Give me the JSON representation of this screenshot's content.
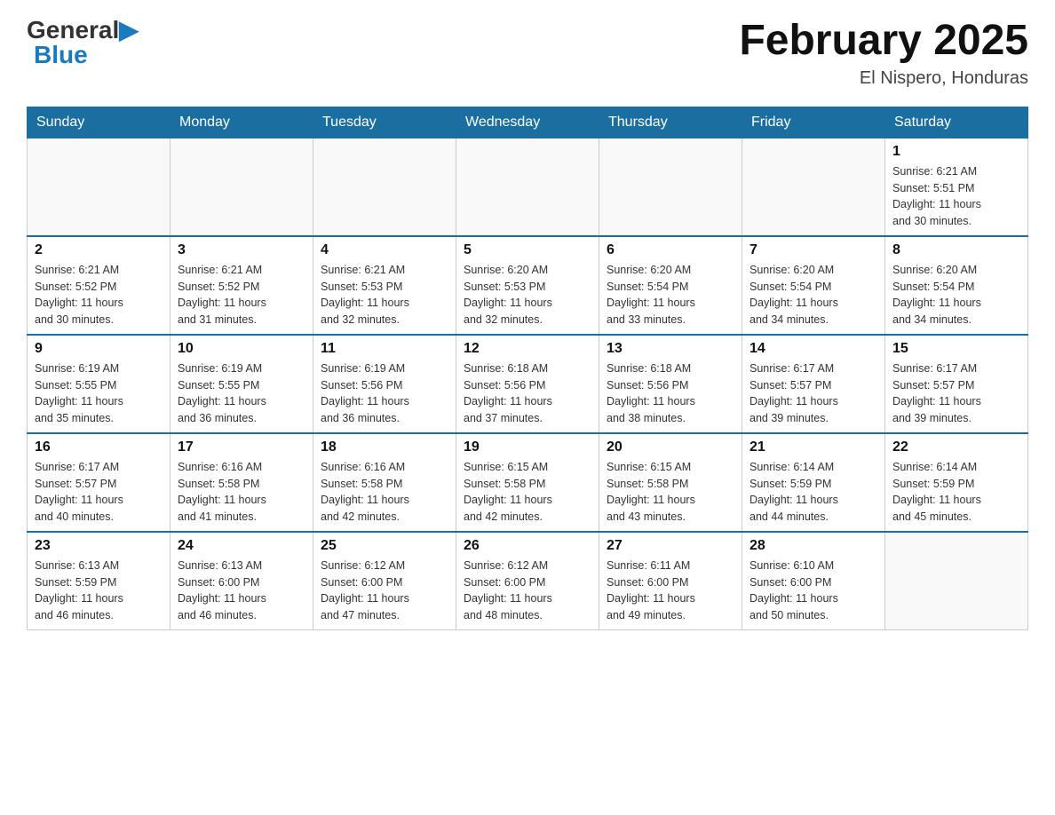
{
  "header": {
    "logo_general": "General",
    "logo_blue": "Blue",
    "title": "February 2025",
    "subtitle": "El Nispero, Honduras"
  },
  "days_of_week": [
    "Sunday",
    "Monday",
    "Tuesday",
    "Wednesday",
    "Thursday",
    "Friday",
    "Saturday"
  ],
  "weeks": [
    [
      {
        "day": "",
        "info": ""
      },
      {
        "day": "",
        "info": ""
      },
      {
        "day": "",
        "info": ""
      },
      {
        "day": "",
        "info": ""
      },
      {
        "day": "",
        "info": ""
      },
      {
        "day": "",
        "info": ""
      },
      {
        "day": "1",
        "info": "Sunrise: 6:21 AM\nSunset: 5:51 PM\nDaylight: 11 hours\nand 30 minutes."
      }
    ],
    [
      {
        "day": "2",
        "info": "Sunrise: 6:21 AM\nSunset: 5:52 PM\nDaylight: 11 hours\nand 30 minutes."
      },
      {
        "day": "3",
        "info": "Sunrise: 6:21 AM\nSunset: 5:52 PM\nDaylight: 11 hours\nand 31 minutes."
      },
      {
        "day": "4",
        "info": "Sunrise: 6:21 AM\nSunset: 5:53 PM\nDaylight: 11 hours\nand 32 minutes."
      },
      {
        "day": "5",
        "info": "Sunrise: 6:20 AM\nSunset: 5:53 PM\nDaylight: 11 hours\nand 32 minutes."
      },
      {
        "day": "6",
        "info": "Sunrise: 6:20 AM\nSunset: 5:54 PM\nDaylight: 11 hours\nand 33 minutes."
      },
      {
        "day": "7",
        "info": "Sunrise: 6:20 AM\nSunset: 5:54 PM\nDaylight: 11 hours\nand 34 minutes."
      },
      {
        "day": "8",
        "info": "Sunrise: 6:20 AM\nSunset: 5:54 PM\nDaylight: 11 hours\nand 34 minutes."
      }
    ],
    [
      {
        "day": "9",
        "info": "Sunrise: 6:19 AM\nSunset: 5:55 PM\nDaylight: 11 hours\nand 35 minutes."
      },
      {
        "day": "10",
        "info": "Sunrise: 6:19 AM\nSunset: 5:55 PM\nDaylight: 11 hours\nand 36 minutes."
      },
      {
        "day": "11",
        "info": "Sunrise: 6:19 AM\nSunset: 5:56 PM\nDaylight: 11 hours\nand 36 minutes."
      },
      {
        "day": "12",
        "info": "Sunrise: 6:18 AM\nSunset: 5:56 PM\nDaylight: 11 hours\nand 37 minutes."
      },
      {
        "day": "13",
        "info": "Sunrise: 6:18 AM\nSunset: 5:56 PM\nDaylight: 11 hours\nand 38 minutes."
      },
      {
        "day": "14",
        "info": "Sunrise: 6:17 AM\nSunset: 5:57 PM\nDaylight: 11 hours\nand 39 minutes."
      },
      {
        "day": "15",
        "info": "Sunrise: 6:17 AM\nSunset: 5:57 PM\nDaylight: 11 hours\nand 39 minutes."
      }
    ],
    [
      {
        "day": "16",
        "info": "Sunrise: 6:17 AM\nSunset: 5:57 PM\nDaylight: 11 hours\nand 40 minutes."
      },
      {
        "day": "17",
        "info": "Sunrise: 6:16 AM\nSunset: 5:58 PM\nDaylight: 11 hours\nand 41 minutes."
      },
      {
        "day": "18",
        "info": "Sunrise: 6:16 AM\nSunset: 5:58 PM\nDaylight: 11 hours\nand 42 minutes."
      },
      {
        "day": "19",
        "info": "Sunrise: 6:15 AM\nSunset: 5:58 PM\nDaylight: 11 hours\nand 42 minutes."
      },
      {
        "day": "20",
        "info": "Sunrise: 6:15 AM\nSunset: 5:58 PM\nDaylight: 11 hours\nand 43 minutes."
      },
      {
        "day": "21",
        "info": "Sunrise: 6:14 AM\nSunset: 5:59 PM\nDaylight: 11 hours\nand 44 minutes."
      },
      {
        "day": "22",
        "info": "Sunrise: 6:14 AM\nSunset: 5:59 PM\nDaylight: 11 hours\nand 45 minutes."
      }
    ],
    [
      {
        "day": "23",
        "info": "Sunrise: 6:13 AM\nSunset: 5:59 PM\nDaylight: 11 hours\nand 46 minutes."
      },
      {
        "day": "24",
        "info": "Sunrise: 6:13 AM\nSunset: 6:00 PM\nDaylight: 11 hours\nand 46 minutes."
      },
      {
        "day": "25",
        "info": "Sunrise: 6:12 AM\nSunset: 6:00 PM\nDaylight: 11 hours\nand 47 minutes."
      },
      {
        "day": "26",
        "info": "Sunrise: 6:12 AM\nSunset: 6:00 PM\nDaylight: 11 hours\nand 48 minutes."
      },
      {
        "day": "27",
        "info": "Sunrise: 6:11 AM\nSunset: 6:00 PM\nDaylight: 11 hours\nand 49 minutes."
      },
      {
        "day": "28",
        "info": "Sunrise: 6:10 AM\nSunset: 6:00 PM\nDaylight: 11 hours\nand 50 minutes."
      },
      {
        "day": "",
        "info": ""
      }
    ]
  ]
}
